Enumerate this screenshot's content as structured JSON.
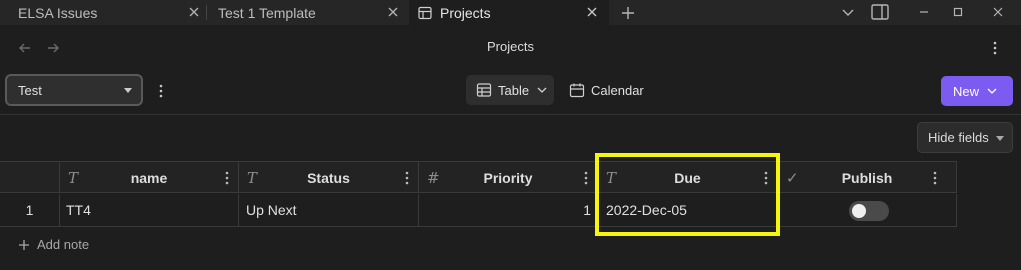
{
  "tabs": [
    {
      "label": "ELSA Issues",
      "active": false
    },
    {
      "label": "Test 1 Template",
      "active": false
    },
    {
      "label": "Projects",
      "active": true
    }
  ],
  "header": {
    "title": "Projects"
  },
  "toolbar": {
    "view_selected": "Test",
    "table_label": "Table",
    "calendar_label": "Calendar",
    "new_label": "New",
    "hide_fields_label": "Hide fields"
  },
  "table": {
    "columns": [
      {
        "label": "name",
        "type_icon": "T"
      },
      {
        "label": "Status",
        "type_icon": "T"
      },
      {
        "label": "Priority",
        "type_icon": "#"
      },
      {
        "label": "Due",
        "type_icon": "T"
      },
      {
        "label": "Publish",
        "type_icon": "✓"
      }
    ],
    "rows": [
      {
        "index": "1",
        "name": "TT4",
        "status": "Up Next",
        "priority": "1",
        "due": "2022-Dec-05",
        "publish": false
      }
    ]
  },
  "add_note_label": "Add note",
  "colors": {
    "accent": "#7c5cf0",
    "highlight": "#f5f50f",
    "background": "#1e1e1e"
  }
}
